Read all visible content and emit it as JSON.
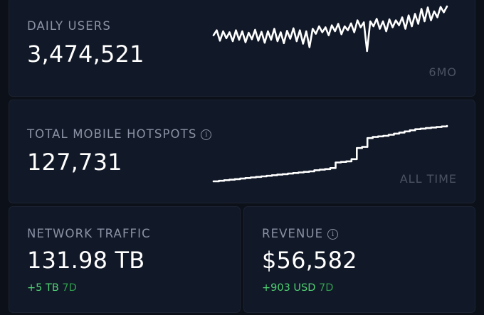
{
  "daily_users": {
    "label": "DAILY USERS",
    "value": "3,474,521",
    "period": "6MO",
    "spark": [
      0.42,
      0.52,
      0.31,
      0.5,
      0.36,
      0.48,
      0.3,
      0.52,
      0.33,
      0.5,
      0.28,
      0.47,
      0.34,
      0.53,
      0.31,
      0.49,
      0.27,
      0.5,
      0.33,
      0.55,
      0.3,
      0.48,
      0.26,
      0.51,
      0.35,
      0.56,
      0.3,
      0.52,
      0.25,
      0.5,
      0.18,
      0.55,
      0.45,
      0.6,
      0.48,
      0.58,
      0.42,
      0.62,
      0.5,
      0.65,
      0.44,
      0.6,
      0.52,
      0.66,
      0.48,
      0.72,
      0.58,
      0.68,
      0.1,
      0.7,
      0.6,
      0.75,
      0.55,
      0.7,
      0.5,
      0.74,
      0.58,
      0.72,
      0.62,
      0.78,
      0.55,
      0.82,
      0.6,
      0.85,
      0.65,
      0.95,
      0.7,
      0.98,
      0.72,
      0.9,
      0.78,
      0.99,
      0.88,
      1.0
    ]
  },
  "hotspots": {
    "label": "TOTAL MOBILE HOTSPOTS",
    "value": "127,731",
    "period": "ALL TIME",
    "spark": [
      0.0,
      0.01,
      0.02,
      0.03,
      0.04,
      0.05,
      0.06,
      0.07,
      0.08,
      0.09,
      0.1,
      0.11,
      0.12,
      0.13,
      0.14,
      0.15,
      0.16,
      0.17,
      0.18,
      0.2,
      0.21,
      0.22,
      0.24,
      0.34,
      0.35,
      0.36,
      0.4,
      0.6,
      0.62,
      0.78,
      0.8,
      0.81,
      0.82,
      0.84,
      0.86,
      0.88,
      0.9,
      0.92,
      0.94,
      0.95,
      0.96,
      0.97,
      0.98,
      0.99,
      1.0
    ]
  },
  "network_traffic": {
    "label": "NETWORK TRAFFIC",
    "value": "131.98 TB",
    "delta_amount": "+5 TB",
    "delta_period": "7D"
  },
  "revenue": {
    "label": "REVENUE",
    "value": "$56,582",
    "delta_amount": "+903 USD",
    "delta_period": "7D"
  },
  "colors": {
    "background": "#0c1018",
    "card": "#111827",
    "label": "#8a92a4",
    "value": "#ffffff",
    "delta_positive": "#4fd173",
    "period_muted": "#4b5363"
  }
}
